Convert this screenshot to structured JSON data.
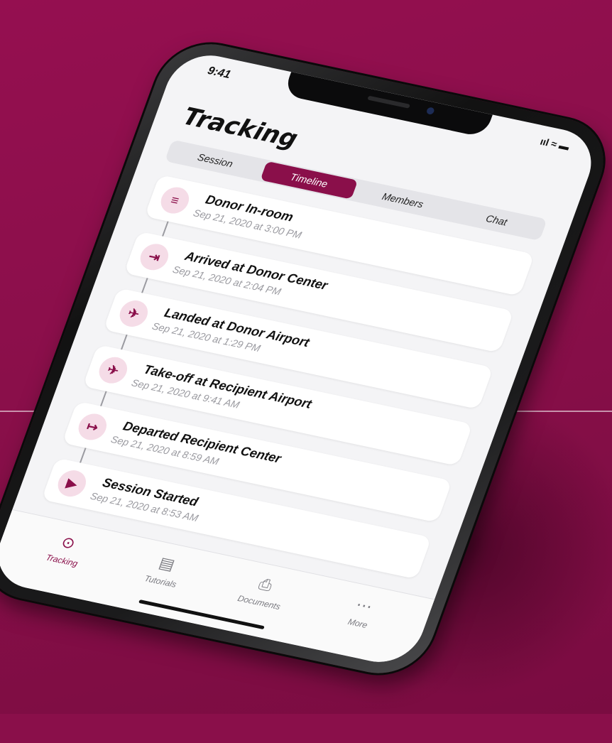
{
  "status": {
    "time": "9:41",
    "icons": " ııl ≈ ▬"
  },
  "header": {
    "title": "Tracking"
  },
  "segments": [
    {
      "label": "Session"
    },
    {
      "label": "Timeline",
      "active": true
    },
    {
      "label": "Members"
    },
    {
      "label": "Chat"
    }
  ],
  "timeline": [
    {
      "title": "Donor In-room",
      "time": "Sep 21, 2020 at 3:00 PM",
      "icon": "bed-icon",
      "glyph": "≡"
    },
    {
      "title": "Arrived at Donor Center",
      "time": "Sep 21, 2020 at 2:04 PM",
      "icon": "arrive-icon",
      "glyph": "⇥"
    },
    {
      "title": "Landed at Donor Airport",
      "time": "Sep 21, 2020 at 1:29 PM",
      "icon": "landing-icon",
      "glyph": "✈"
    },
    {
      "title": "Take-off at Recipient Airport",
      "time": "Sep 21, 2020 at 9:41 AM",
      "icon": "takeoff-icon",
      "glyph": "✈"
    },
    {
      "title": "Departed Recipient Center",
      "time": "Sep 21, 2020 at 8:59 AM",
      "icon": "depart-icon",
      "glyph": "↦"
    },
    {
      "title": "Session Started",
      "time": "Sep 21, 2020 at 8:53 AM",
      "icon": "play-icon",
      "glyph": "▶"
    }
  ],
  "tabbar": [
    {
      "label": "Tracking",
      "icon": "compass-icon",
      "glyph": "⊙",
      "active": true
    },
    {
      "label": "Tutorials",
      "icon": "stack-icon",
      "glyph": "▤"
    },
    {
      "label": "Documents",
      "icon": "document-icon",
      "glyph": "⎙"
    },
    {
      "label": "More",
      "icon": "more-icon",
      "glyph": "⋯"
    }
  ],
  "colors": {
    "accent": "#8a0f4a",
    "background": "#8a0f4a",
    "icon_bg": "#f5dce7"
  }
}
